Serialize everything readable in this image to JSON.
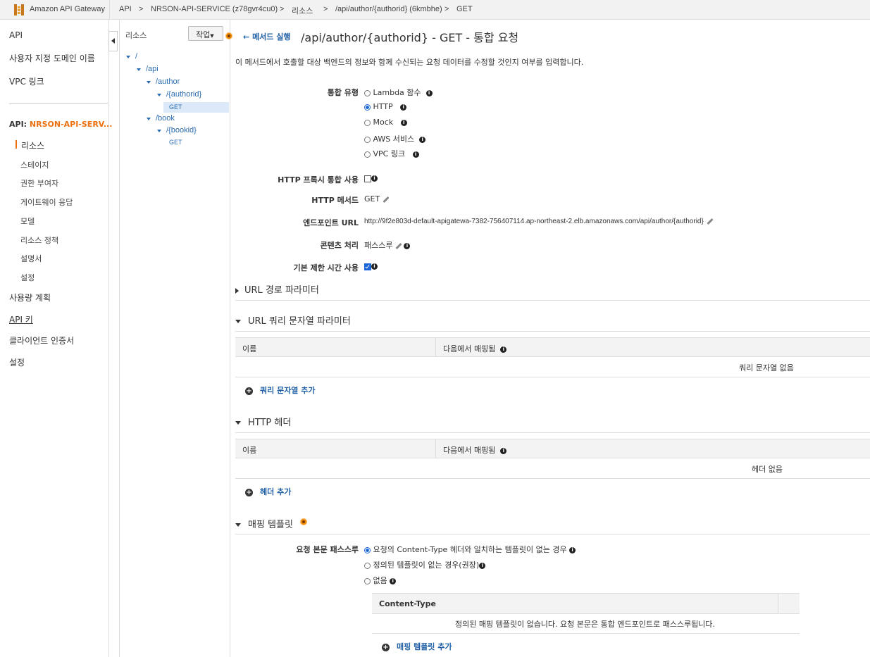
{
  "topbar": {
    "service": "Amazon API Gateway",
    "crumbs": [
      "API",
      "NRSON-API-SERVICE (z78gvr4cu0)",
      "리소스",
      "/api/author/{authorid} (6kmbhe)",
      "GET"
    ],
    "sep": ">"
  },
  "leftnav": {
    "top_items": [
      "API",
      "사용자 지정 도메인 이름",
      "VPC 링크"
    ],
    "api_prefix": "API:",
    "api_name": "NRSON-API-SERV...",
    "sub_items": [
      "리소스",
      "스테이지",
      "권한 부여자",
      "게이트웨이 응답",
      "모델",
      "리소스 정책",
      "설명서",
      "설정"
    ],
    "bottom_items": [
      "사용량 계획",
      "API 키",
      "클라이언트 인증서",
      "설정"
    ]
  },
  "tree": {
    "title": "리소스",
    "action_label": "작업",
    "nodes": [
      "/",
      "/api",
      "/author",
      "/{authorid}",
      "/book",
      "/{bookid}"
    ],
    "methods": [
      "GET",
      "GET"
    ]
  },
  "main": {
    "back_label": "메서드 실행",
    "title": "/api/author/{authorid} - GET - 통합 요청",
    "description": "이 메서드에서 호출할 대상 백엔드의 정보와 함께 수신되는 요청 데이터를 수정할 것인지 여부를 입력합니다.",
    "integration_type_label": "통합 유형",
    "integration_types": [
      "Lambda 함수",
      "HTTP",
      "Mock",
      "AWS 서비스",
      "VPC 링크"
    ],
    "selected_type": "HTTP",
    "proxy_label": "HTTP 프록시 통합 사용",
    "proxy_checked": false,
    "method_label": "HTTP 메서드",
    "method_value": "GET",
    "endpoint_label": "엔드포인트 URL",
    "endpoint_value": "http://9f2e803d-default-apigatewa-7382-756407114.ap-northeast-2.elb.amazonaws.com/api/author/{authorid}",
    "content_label": "콘텐츠 처리",
    "content_value": "패스스루",
    "timeout_label": "기본 제한 시간 사용",
    "timeout_checked": true,
    "sections": {
      "url_path": "URL 경로 파라미터",
      "url_query": "URL 쿼리 문자열 파라미터",
      "http_headers": "HTTP 헤더",
      "mapping": "매핑 템플릿"
    },
    "table_cols": [
      "이름",
      "다음에서 매핑됨"
    ],
    "query_empty": "쿼리 문자열 없음",
    "query_add": "쿼리 문자열 추가",
    "header_empty": "헤더 없음",
    "header_add": "헤더 추가",
    "passthrough_label": "요청 본문 패스스루",
    "passthrough_options": [
      "요청의 Content-Type 헤더와 일치하는 템플릿이 없는 경우",
      "정의된 템플릿이 없는 경우(권장)",
      "없음"
    ],
    "ct_col": "Content-Type",
    "ct_empty": "정의된 매핑 템플릿이 없습니다. 요청 본문은 통합 엔드포인트로 패스스루됩니다.",
    "ct_add": "매핑 템플릿 추가"
  },
  "colors": {
    "accent": "#ec7211",
    "link": "#1f5fa6",
    "radio": "#1a66d9"
  }
}
